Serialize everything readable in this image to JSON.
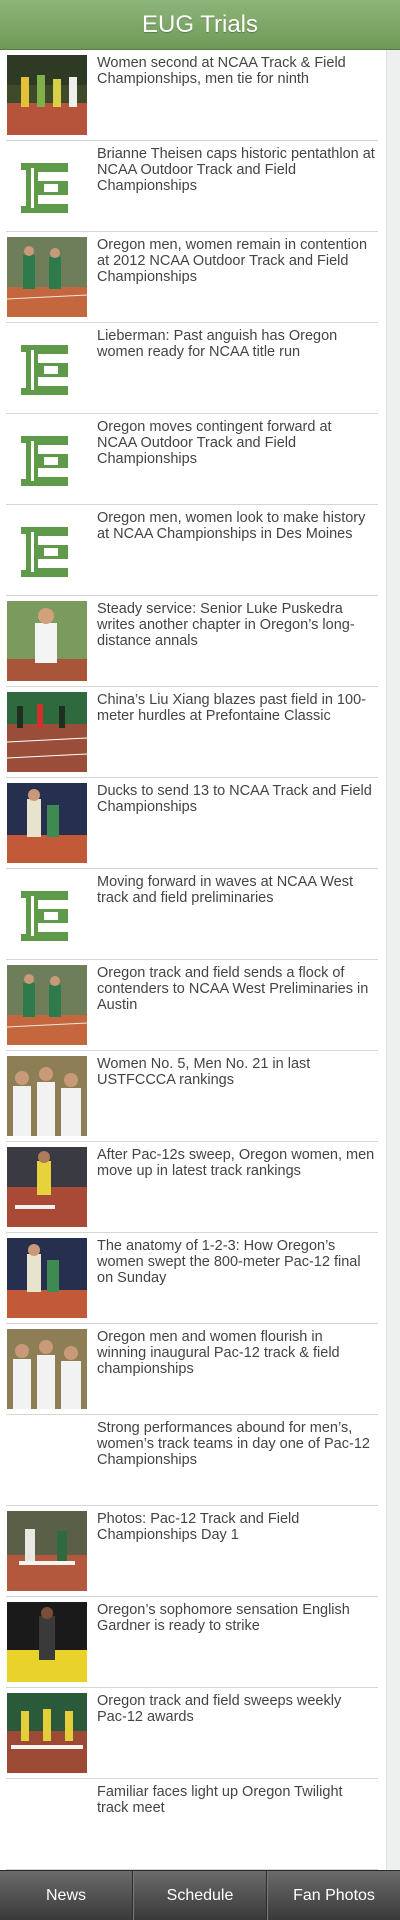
{
  "header": {
    "title": "EUG Trials"
  },
  "articles": [
    {
      "headline": "Women second at NCAA Track & Field Championships, men tie for ninth",
      "thumbnail": "photo-track-race"
    },
    {
      "headline": "Brianne Theisen caps historic pentathlon at NCAA Outdoor Track and Field Championships",
      "thumbnail": "e-logo"
    },
    {
      "headline": "Oregon men, women remain in contention at 2012 NCAA Outdoor Track and Field Championships",
      "thumbnail": "photo-runners-green"
    },
    {
      "headline": "Lieberman: Past anguish has Oregon women ready for NCAA title run",
      "thumbnail": "e-logo"
    },
    {
      "headline": "Oregon moves contingent forward at NCAA Outdoor Track and Field Championships",
      "thumbnail": "e-logo"
    },
    {
      "headline": "Oregon men, women look to make history at NCAA Championships in Des Moines",
      "thumbnail": "e-logo"
    },
    {
      "headline": "Steady service: Senior Luke Puskedra writes another chapter in Oregon’s long-distance annals",
      "thumbnail": "photo-runner-portrait"
    },
    {
      "headline": "China’s Liu Xiang blazes past field in 100-meter hurdles at Prefontaine Classic",
      "thumbnail": "photo-hurdles"
    },
    {
      "headline": "Ducks to send 13 to NCAA Track and Field Championships",
      "thumbnail": "photo-runners-blue"
    },
    {
      "headline": "Moving forward in waves at NCAA West track and field preliminaries",
      "thumbnail": "e-logo"
    },
    {
      "headline": "Oregon track and field sends a flock of contenders to NCAA West Preliminaries in Austin",
      "thumbnail": "photo-runners-green"
    },
    {
      "headline": "Women No. 5, Men No. 21 in last USTFCCCA rankings",
      "thumbnail": "photo-celebration"
    },
    {
      "headline": "After Pac-12s sweep, Oregon women, men move up in latest track rankings",
      "thumbnail": "photo-hurdler"
    },
    {
      "headline": "The anatomy of 1-2-3: How Oregon’s women swept the 800-meter Pac-12 final on Sunday",
      "thumbnail": "photo-runners-blue"
    },
    {
      "headline": "Oregon men and women flourish in winning inaugural Pac-12 track & field championships",
      "thumbnail": "photo-celebration"
    },
    {
      "headline": "Strong performances abound for men’s, women’s track teams in day one of Pac-12 Championships",
      "thumbnail": "none"
    },
    {
      "headline": "Photos: Pac-12 Track and Field Championships Day 1",
      "thumbnail": "photo-hurdles-crowd"
    },
    {
      "headline": "Oregon’s sophomore sensation English Gardner is ready to strike",
      "thumbnail": "photo-sprinter-yellow"
    },
    {
      "headline": "Oregon track and field sweeps weekly Pac-12 awards",
      "thumbnail": "photo-hurdles-race"
    },
    {
      "headline": "Familiar faces light up Oregon Twilight track meet",
      "thumbnail": "none"
    }
  ],
  "tabs": [
    {
      "label": "News"
    },
    {
      "label": "Schedule"
    },
    {
      "label": "Fan Photos"
    }
  ],
  "colors": {
    "header_green": "#7aa663",
    "logo_green": "#5e9a4a",
    "headline_text": "#444444",
    "tabbar": "#4a4a4a"
  }
}
